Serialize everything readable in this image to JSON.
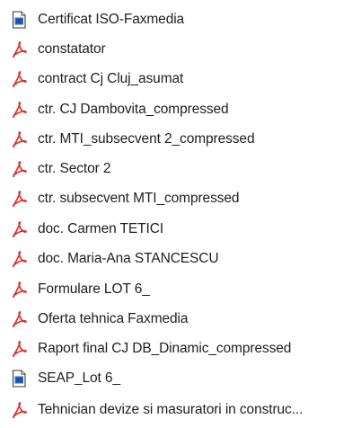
{
  "files": [
    {
      "name": "Certificat ISO-Faxmedia",
      "icon": "word-document-icon"
    },
    {
      "name": "constatator",
      "icon": "pdf-file-icon"
    },
    {
      "name": "contract Cj Cluj_asumat",
      "icon": "pdf-file-icon"
    },
    {
      "name": "ctr. CJ Dambovita_compressed",
      "icon": "pdf-file-icon"
    },
    {
      "name": "ctr. MTI_subsecvent 2_compressed",
      "icon": "pdf-file-icon"
    },
    {
      "name": "ctr. Sector 2",
      "icon": "pdf-file-icon"
    },
    {
      "name": "ctr. subsecvent MTI_compressed",
      "icon": "pdf-file-icon"
    },
    {
      "name": "doc. Carmen TETICI",
      "icon": "pdf-file-icon"
    },
    {
      "name": "doc. Maria-Ana STANCESCU",
      "icon": "pdf-file-icon"
    },
    {
      "name": "Formulare LOT 6_",
      "icon": "pdf-file-icon"
    },
    {
      "name": "Oferta tehnica Faxmedia",
      "icon": "pdf-file-icon"
    },
    {
      "name": "Raport final CJ DB_Dinamic_compressed",
      "icon": "pdf-file-icon"
    },
    {
      "name": "SEAP_Lot 6_",
      "icon": "word-document-icon"
    },
    {
      "name": "Tehnician devize si masuratori in construc...",
      "icon": "pdf-file-icon"
    }
  ],
  "colors": {
    "pdf_red": "#d9342b",
    "doc_blue": "#2b6cc4",
    "text": "#1f1f1f"
  }
}
